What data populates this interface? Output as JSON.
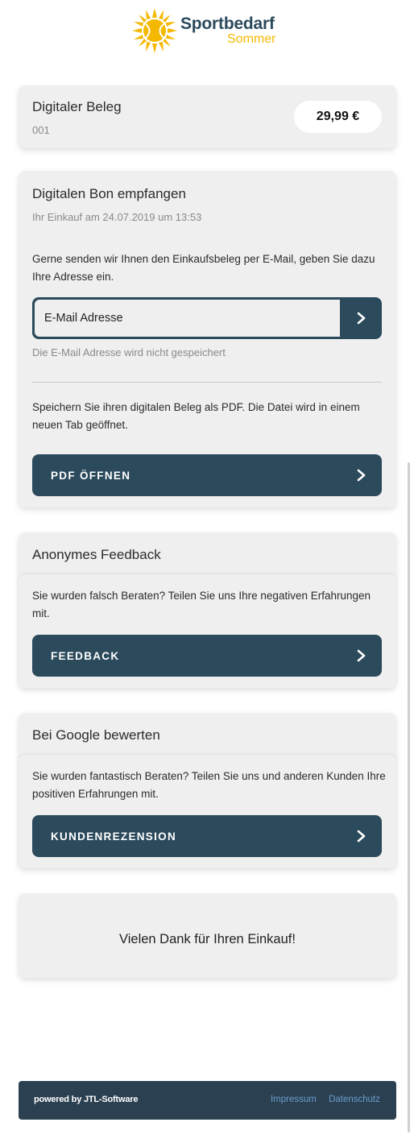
{
  "brand": {
    "name": "Sportbedarf",
    "subtitle": "Sommer",
    "accent": "#f5b800"
  },
  "receipt": {
    "title": "Digitaler Beleg",
    "number": "001",
    "total": "29,99 €"
  },
  "bon": {
    "title": "Digitalen Bon empfangen",
    "purchase_info": "Ihr Einkauf am 24.07.2019 um 13:53",
    "email_prompt": "Gerne senden wir Ihnen den Einkaufsbeleg per E-Mail, geben Sie dazu Ihre Adresse ein.",
    "email_placeholder": "E-Mail Adresse",
    "email_note": "Die E-Mail Adresse wird nicht gespeichert",
    "pdf_text": "Speichern Sie ihren digitalen Beleg als PDF. Die Datei wird in einem neuen Tab geöffnet.",
    "pdf_button": "PDF ÖFFNEN"
  },
  "feedback": {
    "title": "Anonymes Feedback",
    "text": "Sie wurden falsch Beraten? Teilen Sie uns Ihre negativen Erfahrungen mit.",
    "button": "FEEDBACK"
  },
  "google": {
    "title": "Bei Google bewerten",
    "text": "Sie wurden fantastisch Beraten? Teilen Sie uns und anderen Kunden Ihre positiven Erfahrungen mit.",
    "button": "KUNDENREZENSION"
  },
  "thanks": "Vielen Dank für Ihren Einkauf!",
  "footer": {
    "powered_by": "powered by JTL-Software",
    "impressum": "Impressum",
    "datenschutz": "Datenschutz"
  },
  "icons": {
    "logo": "sun-ball-icon",
    "arrow": "chevron-right-icon"
  },
  "colors": {
    "primary": "#2b4a5c",
    "card": "#efefef",
    "link": "#6b9ccc"
  }
}
